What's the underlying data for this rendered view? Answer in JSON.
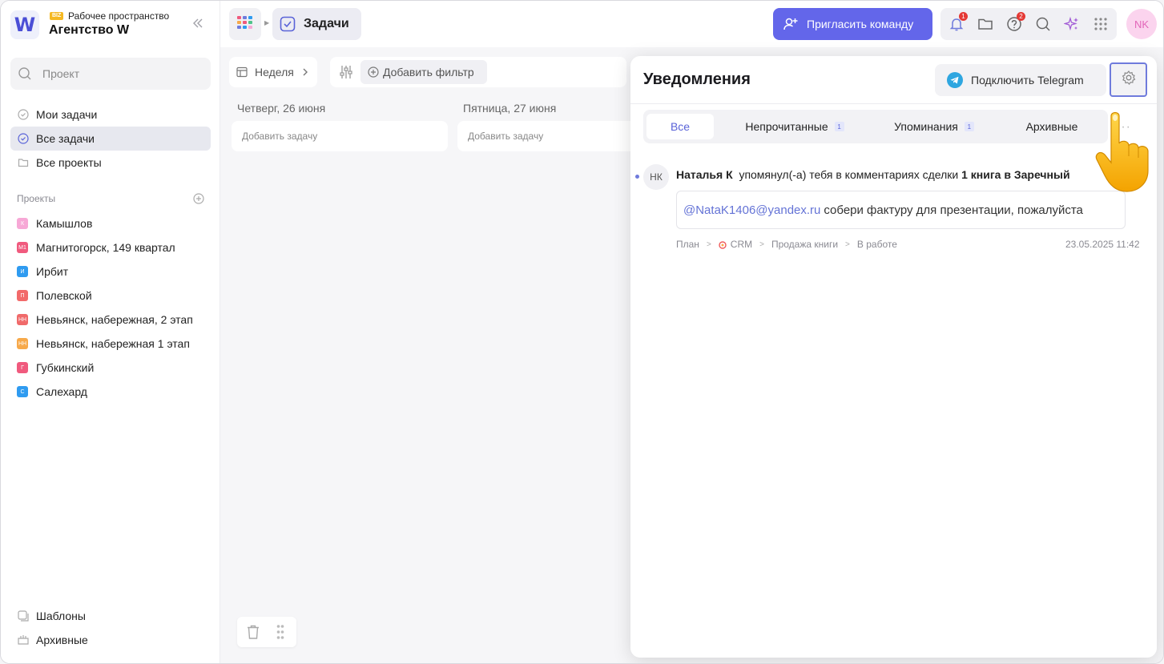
{
  "workspace": {
    "badge": "BIZ",
    "label": "Рабочее пространство",
    "name": "Агентство W",
    "logo_letter": "W"
  },
  "sidebar": {
    "search_placeholder": "Проект",
    "nav": [
      {
        "label": "Мои задачи",
        "icon": "check-circle-icon"
      },
      {
        "label": "Все задачи",
        "icon": "check-circle-icon",
        "active": true
      },
      {
        "label": "Все проекты",
        "icon": "folder-icon"
      }
    ],
    "projects_title": "Проекты",
    "projects": [
      {
        "abbr": "К",
        "label": "Камышлов",
        "color": "#f7a8d6"
      },
      {
        "abbr": "М1",
        "label": "Магнитогорск, 149 квартал",
        "color": "#f05a7e"
      },
      {
        "abbr": "И",
        "label": "Ирбит",
        "color": "#2f9bf0"
      },
      {
        "abbr": "П",
        "label": "Полевской",
        "color": "#f26a6a"
      },
      {
        "abbr": "НН",
        "label": "Невьянск, набережная, 2 этап",
        "color": "#f06a6a"
      },
      {
        "abbr": "НН",
        "label": "Невьянск, набережная 1 этап",
        "color": "#f7a94a"
      },
      {
        "abbr": "Г",
        "label": "Губкинский",
        "color": "#f05a7e"
      },
      {
        "abbr": "С",
        "label": "Салехард",
        "color": "#2f9bf0"
      }
    ],
    "bottom": [
      {
        "label": "Шаблоны",
        "icon": "templates-icon"
      },
      {
        "label": "Архивные",
        "icon": "archive-icon"
      }
    ]
  },
  "topbar": {
    "page_title": "Задачи",
    "invite_label": "Пригласить команду",
    "notif_count": "1",
    "help_count": "2",
    "avatar_initials": "NK"
  },
  "board": {
    "period_label": "Неделя",
    "add_filter_label": "Добавить фильтр",
    "days": [
      {
        "title": "Четверг, 26 июня",
        "add_task": "Добавить задачу"
      },
      {
        "title": "Пятница, 27 июня",
        "add_task": "Добавить задачу"
      }
    ]
  },
  "notifications": {
    "title": "Уведомления",
    "telegram_label": "Подключить Telegram",
    "tabs": [
      {
        "label": "Все",
        "active": true
      },
      {
        "label": "Непрочитанные",
        "count": "1"
      },
      {
        "label": "Упоминания",
        "count": "1"
      },
      {
        "label": "Архивные"
      }
    ],
    "items": [
      {
        "avatar": "НК",
        "author": "Наталья К",
        "action": "упомянул(-а) тебя в комментариях сделки",
        "target": "1 книга в Заречный",
        "mention": "@NataK1406@yandex.ru",
        "message": "собери фактуру для презентации, пожалуйста",
        "path": [
          "План",
          "CRM",
          "Продажа книги",
          "В работе"
        ],
        "time": "23.05.2025 11:42"
      }
    ]
  },
  "colors": {
    "accent": "#6366ea",
    "active_tab_text": "#5a63d8",
    "badge_red": "#e53935"
  }
}
